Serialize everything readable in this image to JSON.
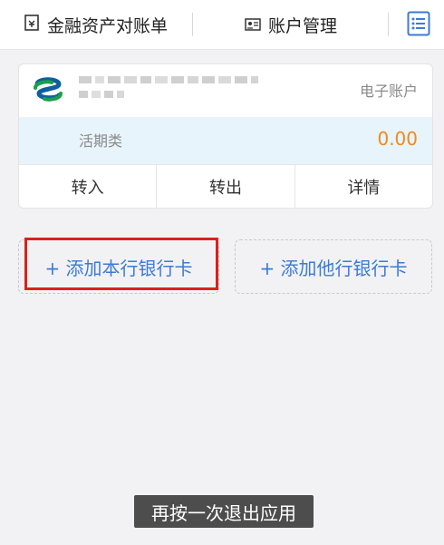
{
  "header": {
    "tab_statement": "金融资产对账单",
    "tab_manage": "账户管理"
  },
  "account": {
    "type": "电子账户",
    "category": "活期类",
    "balance": "0.00",
    "actions": [
      "转入",
      "转出",
      "详情"
    ]
  },
  "add_cards": {
    "own_bank": "+ 添加本行银行卡",
    "other_bank": "+ 添加他行银行卡"
  },
  "toast": "再按一次退出应用",
  "colors": {
    "accent_blue": "#3a7bd5",
    "balance_orange": "#f08a1c",
    "highlight_red": "#d9221c"
  }
}
